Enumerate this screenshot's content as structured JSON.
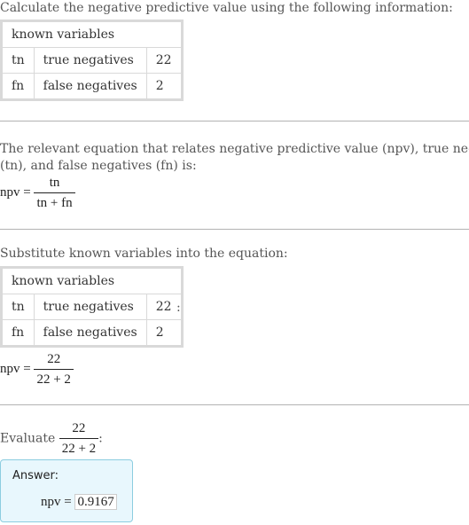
{
  "intro": "Calculate the negative predictive value using the following information:",
  "table": {
    "header": "known variables",
    "rows": [
      {
        "symbol": "tn",
        "name": "true negatives",
        "value": "22"
      },
      {
        "symbol": "fn",
        "name": "false negatives",
        "value": "2"
      }
    ]
  },
  "equation_section": {
    "line1": "The relevant equation that relates negative predictive value (npv), true negatives",
    "line2": "(tn), and false negatives (fn) is:",
    "lhs": "npv =",
    "numerator": "tn",
    "denominator": "tn + fn"
  },
  "substitute_section": {
    "text": "Substitute known variables into the equation:",
    "colon": ":",
    "lhs": "npv =",
    "numerator": "22",
    "denominator": "22 + 2"
  },
  "evaluate_section": {
    "label": "Evaluate",
    "numerator": "22",
    "denominator": "22 + 2",
    "colon": ":"
  },
  "answer": {
    "label": "Answer:",
    "lhs": "npv =",
    "value": "0.9167"
  },
  "colors": {
    "answer_bg": "#e8f7fd",
    "answer_border": "#8ccde0",
    "table_border": "#d9d9d9"
  }
}
